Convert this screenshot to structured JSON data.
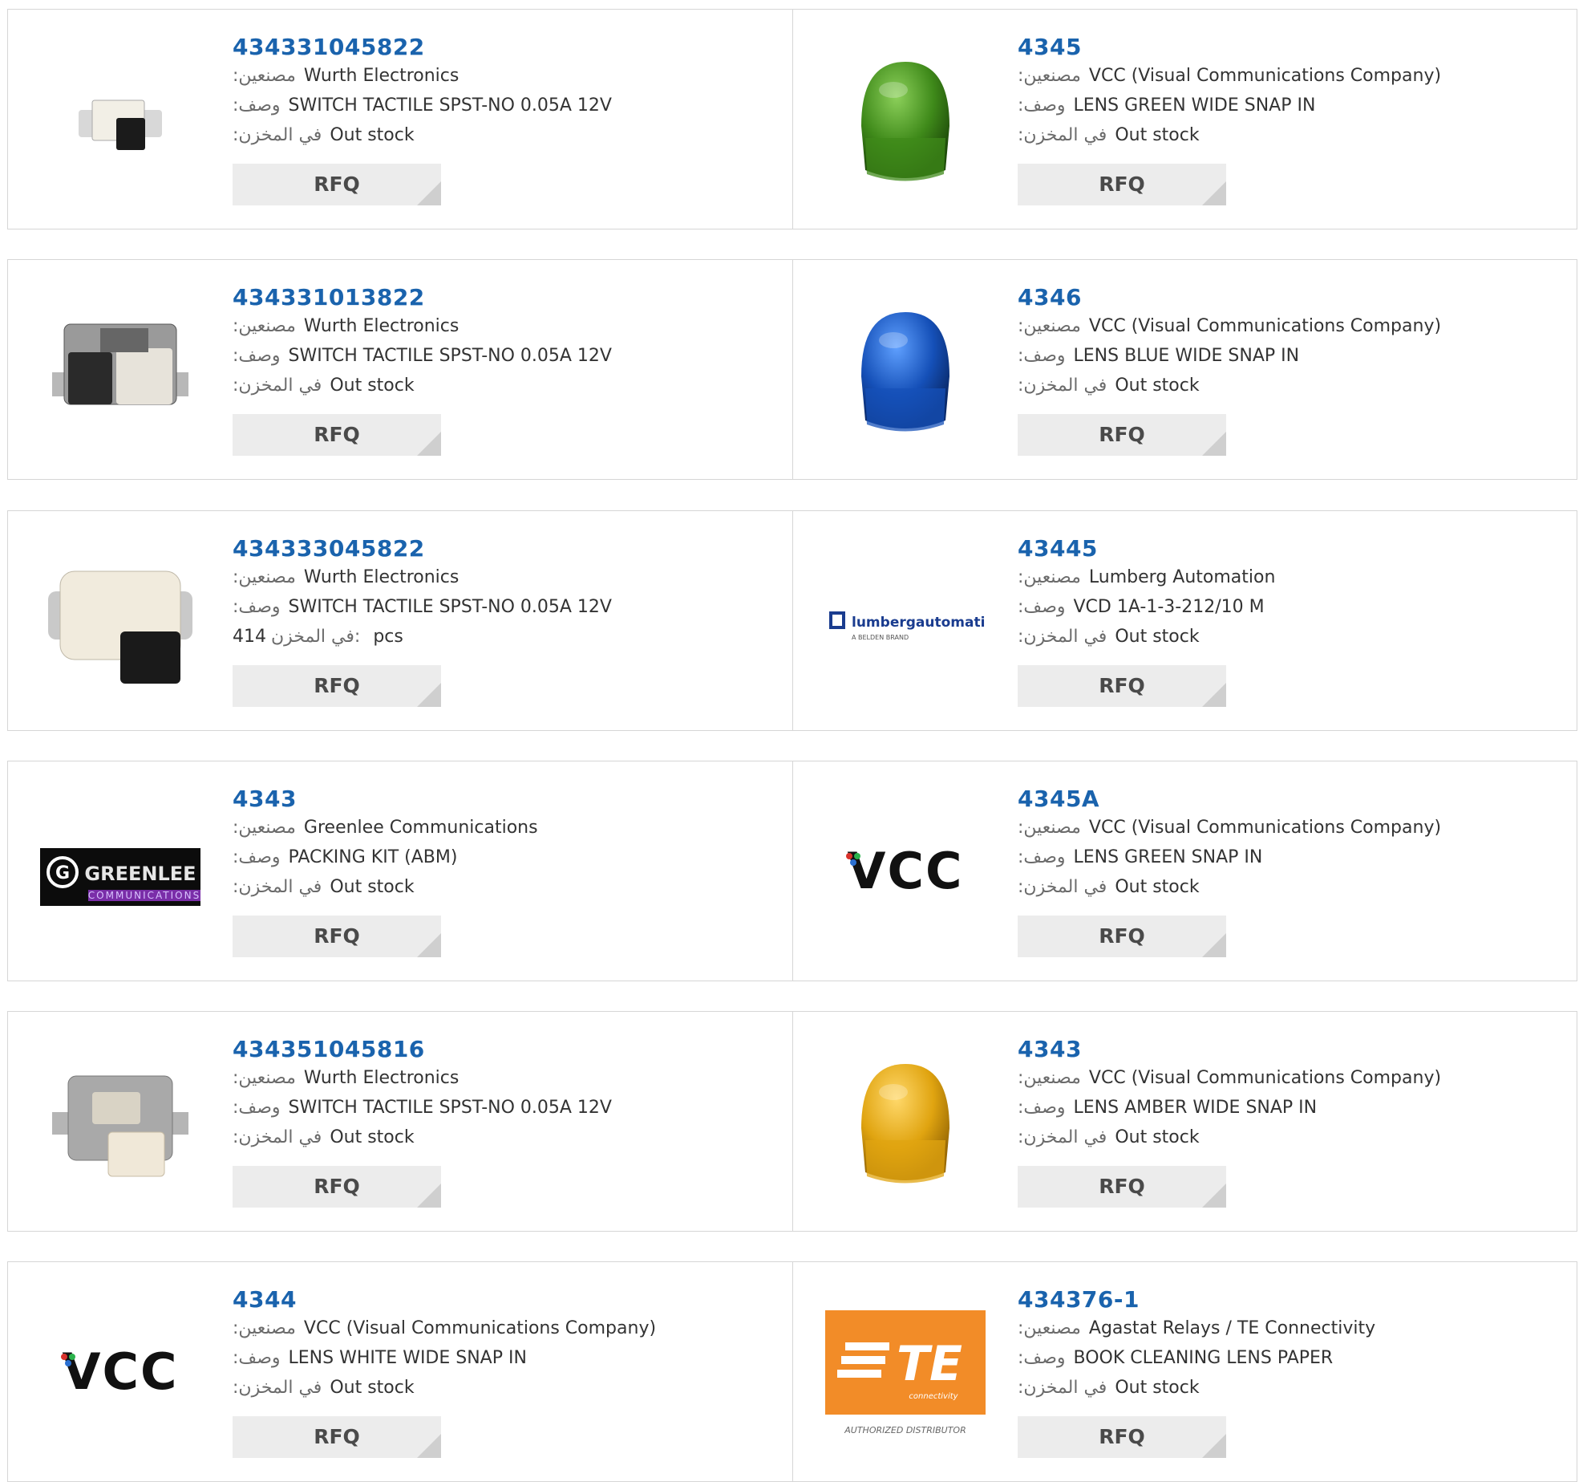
{
  "labels": {
    "manufacturer": ":مصنعين",
    "description": ":وصف",
    "stock": ":في المخزن",
    "stock_inline": "في المخزن:",
    "rfq": "RFQ"
  },
  "colors": {
    "link": "#1a63ad",
    "button_bg": "#ececec",
    "border": "#d6d6d6"
  },
  "products": [
    {
      "part": "434331045822",
      "manufacturer": "Wurth Electronics",
      "description": "SWITCH TACTILE SPST-NO 0.05A 12V",
      "stock": "Out stock",
      "image": "tactile-switch-small-icon"
    },
    {
      "part": "4345",
      "manufacturer": "VCC (Visual Communications Company)",
      "description": "LENS GREEN WIDE SNAP IN",
      "stock": "Out stock",
      "image": "green-lens-icon"
    },
    {
      "part": "434331013822",
      "manufacturer": "Wurth Electronics",
      "description": "SWITCH TACTILE SPST-NO 0.05A 12V",
      "stock": "Out stock",
      "image": "tactile-switch-black-icon"
    },
    {
      "part": "4346",
      "manufacturer": "VCC (Visual Communications Company)",
      "description": "LENS BLUE WIDE SNAP IN",
      "stock": "Out stock",
      "image": "blue-lens-icon"
    },
    {
      "part": "434333045822",
      "manufacturer": "Wurth Electronics",
      "description": "SWITCH TACTILE SPST-NO 0.05A 12V",
      "stock_qty": "414",
      "stock_unit": "pcs",
      "image": "tactile-switch-white-icon"
    },
    {
      "part": "43445",
      "manufacturer": "Lumberg Automation",
      "description": "VCD 1A-1-3-212/10 M",
      "stock": "Out stock",
      "image": "lumberg-logo",
      "logo_text": "lumbergautomation",
      "logo_sub": "A BELDEN BRAND"
    },
    {
      "part": "4343",
      "manufacturer": "Greenlee Communications",
      "description": "PACKING KIT (ABM)",
      "stock": "Out stock",
      "image": "greenlee-logo",
      "logo_text": "GREENLEE",
      "logo_sub": "COMMUNICATIONS"
    },
    {
      "part": "4345A",
      "manufacturer": "VCC (Visual Communications Company)",
      "description": "LENS GREEN SNAP IN",
      "stock": "Out stock",
      "image": "vcc-logo",
      "logo_text": "VCC"
    },
    {
      "part": "434351045816",
      "manufacturer": "Wurth Electronics",
      "description": "SWITCH TACTILE SPST-NO 0.05A 12V",
      "stock": "Out stock",
      "image": "tactile-switch-side-icon"
    },
    {
      "part": "4343",
      "manufacturer": "VCC (Visual Communications Company)",
      "description": "LENS AMBER WIDE SNAP IN",
      "stock": "Out stock",
      "image": "amber-lens-icon"
    },
    {
      "part": "4344",
      "manufacturer": "VCC (Visual Communications Company)",
      "description": "LENS WHITE WIDE SNAP IN",
      "stock": "Out stock",
      "image": "vcc-logo",
      "logo_text": "VCC"
    },
    {
      "part": "434376-1",
      "manufacturer": "Agastat Relays / TE Connectivity",
      "description": "BOOK CLEANING LENS PAPER",
      "stock": "Out stock",
      "image": "te-connectivity-logo",
      "logo_text": "TE",
      "logo_sub": "connectivity",
      "logo_caption": "AUTHORIZED DISTRIBUTOR"
    }
  ]
}
